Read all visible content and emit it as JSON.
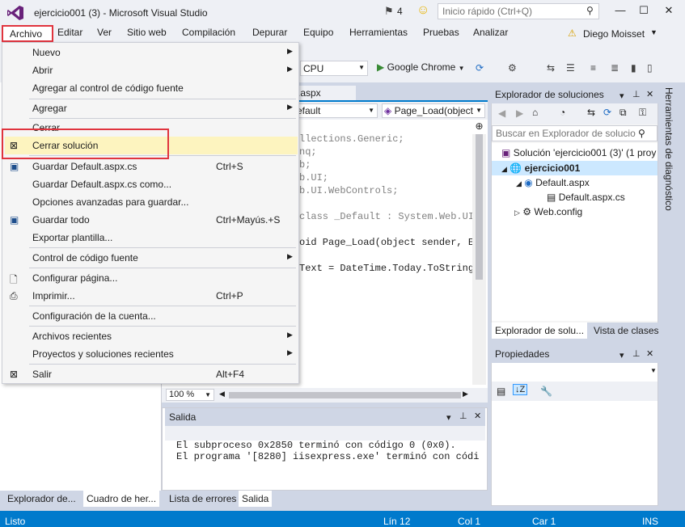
{
  "window": {
    "title": "ejercicio001 (3) - Microsoft Visual Studio",
    "notifications_count": "4",
    "quick_launch_placeholder": "Inicio rápido (Ctrl+Q)",
    "minimize": "—",
    "maximize": "☐",
    "close": "✕"
  },
  "menubar": {
    "items": [
      "Archivo",
      "Editar",
      "Ver",
      "Sitio web",
      "Compilación",
      "Depurar",
      "Equipo",
      "Herramientas",
      "Pruebas",
      "Analizar"
    ],
    "user": "Diego Moisset"
  },
  "toolbar": {
    "platform": "CPU",
    "run_target": "Google Chrome"
  },
  "file_menu": {
    "items": [
      {
        "label": "Nuevo",
        "submenu": true
      },
      {
        "label": "Abrir",
        "submenu": true
      },
      {
        "label": "Agregar al control de código fuente"
      },
      {
        "label": "Agregar",
        "submenu": true
      },
      {
        "label": "Cerrar"
      },
      {
        "label": "Cerrar solución"
      },
      {
        "label": "Guardar Default.aspx.cs",
        "shortcut": "Ctrl+S"
      },
      {
        "label": "Guardar Default.aspx.cs como..."
      },
      {
        "label": "Opciones avanzadas para guardar..."
      },
      {
        "label": "Guardar todo",
        "shortcut": "Ctrl+Mayús.+S"
      },
      {
        "label": "Exportar plantilla..."
      },
      {
        "label": "Control de código fuente",
        "submenu": true
      },
      {
        "label": "Configurar página..."
      },
      {
        "label": "Imprimir...",
        "shortcut": "Ctrl+P"
      },
      {
        "label": "Configuración de la cuenta..."
      },
      {
        "label": "Archivos recientes",
        "submenu": true
      },
      {
        "label": "Proyectos y soluciones recientes",
        "submenu": true
      },
      {
        "label": "Salir",
        "shortcut": "Alt+F4"
      }
    ],
    "highlighted": "Cerrar solución"
  },
  "editor": {
    "tab": ".aspx",
    "nav_left": "efault",
    "nav_right": "Page_Load(object",
    "code_lines": [
      "llections.Generic;",
      "nq;",
      "b;",
      "b.UI;",
      "b.UI.WebControls;",
      "",
      "class _Default : System.Web.UI.",
      "",
      "oid Page_Load(object sender, Ev",
      "",
      "Text = DateTime.Today.ToString("
    ],
    "zoom": "100 %"
  },
  "output": {
    "title": "Salida",
    "lines": [
      "El subproceso 0x2850 terminó con código 0 (0x0).",
      "El programa '[8280] iisexpress.exe' terminó con códi"
    ],
    "tabs": [
      "Lista de errores",
      "Salida"
    ]
  },
  "left_panel": {
    "tabs": [
      "Explorador de...",
      "Cuadro de her..."
    ]
  },
  "solution_explorer": {
    "title": "Explorador de soluciones",
    "search_placeholder": "Buscar en Explorador de solucio",
    "solution": "Solución 'ejercicio001 (3)' (1 proy",
    "project": "ejercicio001",
    "file1": "Default.aspx",
    "file1_child": "Default.aspx.cs",
    "file2": "Web.config",
    "tabs": [
      "Explorador de solu...",
      "Vista de clases"
    ]
  },
  "properties": {
    "title": "Propiedades"
  },
  "right_strip": {
    "label": "Herramientas de diagnóstico"
  },
  "statusbar": {
    "state": "Listo",
    "line": "Lín 12",
    "col": "Col 1",
    "car": "Car 1",
    "mode": "INS"
  },
  "colors": {
    "accent": "#007acc",
    "highlight": "#e0343e",
    "menu_hover": "#fdf4bf"
  }
}
